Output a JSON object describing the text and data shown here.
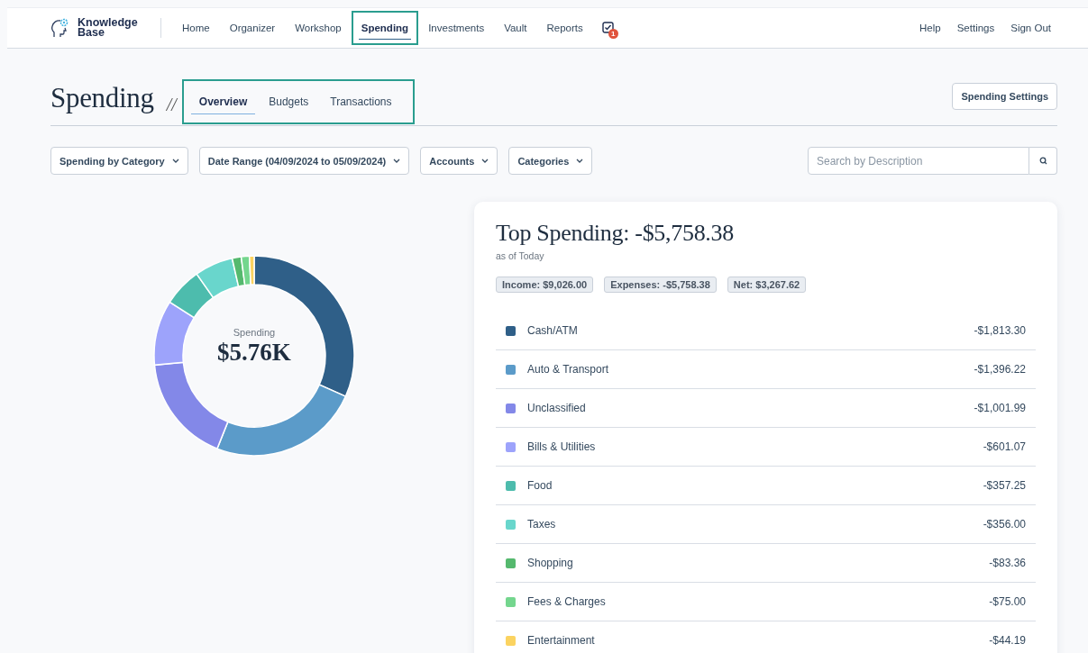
{
  "nav": {
    "logo_text": "Knowledge Base",
    "items": [
      {
        "label": "Home",
        "selected": false,
        "highlighted": false
      },
      {
        "label": "Organizer",
        "selected": false,
        "highlighted": false
      },
      {
        "label": "Workshop",
        "selected": false,
        "highlighted": false
      },
      {
        "label": "Spending",
        "selected": true,
        "highlighted": true
      },
      {
        "label": "Investments",
        "selected": false,
        "highlighted": false
      },
      {
        "label": "Vault",
        "selected": false,
        "highlighted": false
      },
      {
        "label": "Reports",
        "selected": false,
        "highlighted": false
      }
    ],
    "tasks_badge": "1",
    "right_links": [
      "Help",
      "Settings",
      "Sign Out"
    ]
  },
  "page": {
    "title": "Spending",
    "separator": "//",
    "tabs_highlighted": true,
    "tabs": [
      {
        "label": "Overview",
        "selected": true
      },
      {
        "label": "Budgets",
        "selected": false
      },
      {
        "label": "Transactions",
        "selected": false
      }
    ],
    "settings_button": "Spending Settings"
  },
  "filters": [
    {
      "label": "Spending by Category"
    },
    {
      "label": "Date Range (04/09/2024 to 05/09/2024)"
    },
    {
      "label": "Accounts"
    },
    {
      "label": "Categories"
    }
  ],
  "search": {
    "placeholder": "Search by Description"
  },
  "donut": {
    "caption": "Spending",
    "total": "$5.76K",
    "chart_data": {
      "type": "donut",
      "values": [
        31.66,
        24.37,
        17.49,
        10.49,
        6.24,
        6.21,
        1.46,
        1.31,
        0.77
      ]
    }
  },
  "summary": {
    "title": "Top Spending: -$5,758.38",
    "subtitle": "as of Today",
    "pills": [
      "Income: $9,026.00",
      "Expenses: -$5,758.38",
      "Net: $3,267.62"
    ],
    "categories": [
      {
        "name": "Cash/ATM",
        "amount": "-$1,813.30",
        "color": "#2f5f88"
      },
      {
        "name": "Auto & Transport",
        "amount": "-$1,396.22",
        "color": "#5b9bc9"
      },
      {
        "name": "Unclassified",
        "amount": "-$1,001.99",
        "color": "#8388e8"
      },
      {
        "name": "Bills & Utilities",
        "amount": "-$601.07",
        "color": "#9da3fb"
      },
      {
        "name": "Food",
        "amount": "-$357.25",
        "color": "#4dbcad"
      },
      {
        "name": "Taxes",
        "amount": "-$356.00",
        "color": "#69d6cc"
      },
      {
        "name": "Shopping",
        "amount": "-$83.36",
        "color": "#55b96e"
      },
      {
        "name": "Fees & Charges",
        "amount": "-$75.00",
        "color": "#74d68e"
      },
      {
        "name": "Entertainment",
        "amount": "-$44.19",
        "color": "#fbd360"
      }
    ]
  }
}
